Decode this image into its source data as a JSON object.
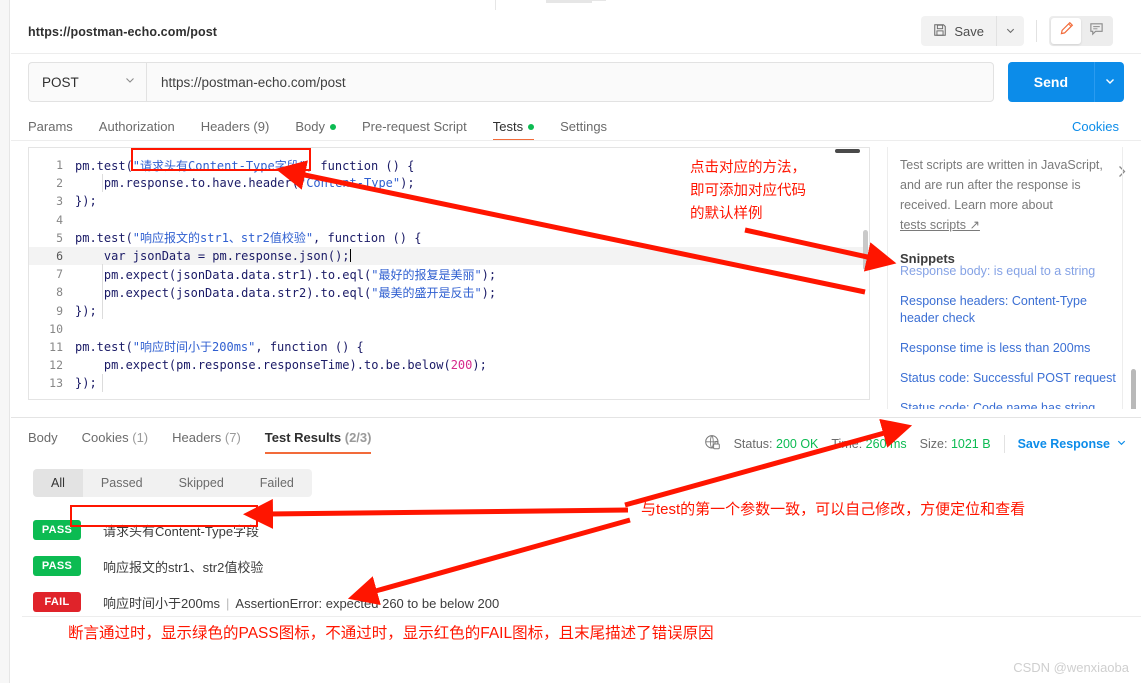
{
  "window": {
    "request_title": "https://postman-echo.com/post"
  },
  "header": {
    "save_label": "Save",
    "save_icon": "floppy-disk-icon",
    "caret_icon": "chevron-down-icon",
    "edit_icon": "pencil-icon",
    "comment_icon": "comment-icon"
  },
  "url_bar": {
    "method": "POST",
    "url": "https://postman-echo.com/post",
    "send_label": "Send"
  },
  "request_tabs": {
    "items": [
      {
        "label": "Params",
        "active": false,
        "dot": false
      },
      {
        "label": "Authorization",
        "active": false,
        "dot": false
      },
      {
        "label": "Headers (9)",
        "active": false,
        "dot": false
      },
      {
        "label": "Body",
        "active": false,
        "dot": true
      },
      {
        "label": "Pre-request Script",
        "active": false,
        "dot": false
      },
      {
        "label": "Tests",
        "active": true,
        "dot": true
      },
      {
        "label": "Settings",
        "active": false,
        "dot": false
      }
    ],
    "cookies_link": "Cookies"
  },
  "editor": {
    "lines": [
      {
        "n": "1",
        "seg": [
          {
            "t": "pm.test(",
            "c": "plain"
          },
          {
            "t": "\"请求头有Content-Type字段\"",
            "c": "str"
          },
          {
            "t": ", function () {",
            "c": "plain"
          }
        ]
      },
      {
        "n": "2",
        "seg": [
          {
            "t": "    pm.response.to.have.header(",
            "c": "plain"
          },
          {
            "t": "\"Content-Type\"",
            "c": "str"
          },
          {
            "t": ");",
            "c": "plain"
          }
        ]
      },
      {
        "n": "3",
        "seg": [
          {
            "t": "});",
            "c": "plain"
          }
        ]
      },
      {
        "n": "4",
        "seg": []
      },
      {
        "n": "5",
        "seg": [
          {
            "t": "pm.test(",
            "c": "plain"
          },
          {
            "t": "\"响应报文的str1、str2值校验\"",
            "c": "str"
          },
          {
            "t": ", function () {",
            "c": "plain"
          }
        ]
      },
      {
        "n": "6",
        "seg": [
          {
            "t": "    var jsonData = pm.response.json();",
            "c": "plain"
          }
        ],
        "highlight": true,
        "caret": true
      },
      {
        "n": "7",
        "seg": [
          {
            "t": "    pm.expect(jsonData.data.str1).to.eql(",
            "c": "plain"
          },
          {
            "t": "\"最好的报复是美丽\"",
            "c": "str"
          },
          {
            "t": ");",
            "c": "plain"
          }
        ]
      },
      {
        "n": "8",
        "seg": [
          {
            "t": "    pm.expect(jsonData.data.str2).to.eql(",
            "c": "plain"
          },
          {
            "t": "\"最美的盛开是反击\"",
            "c": "str"
          },
          {
            "t": ");",
            "c": "plain"
          }
        ]
      },
      {
        "n": "9",
        "seg": [
          {
            "t": "});",
            "c": "plain"
          }
        ]
      },
      {
        "n": "10",
        "seg": []
      },
      {
        "n": "11",
        "seg": [
          {
            "t": "pm.test(",
            "c": "plain"
          },
          {
            "t": "\"响应时间小于200ms\"",
            "c": "str"
          },
          {
            "t": ", function () {",
            "c": "plain"
          }
        ]
      },
      {
        "n": "12",
        "seg": [
          {
            "t": "    pm.expect(pm.response.responseTime).to.be.below(",
            "c": "plain"
          },
          {
            "t": "200",
            "c": "num"
          },
          {
            "t": ");",
            "c": "plain"
          }
        ]
      },
      {
        "n": "13",
        "seg": [
          {
            "t": "});",
            "c": "plain"
          }
        ]
      }
    ]
  },
  "snippets": {
    "description_line1": "Test scripts are written in JavaScript,",
    "description_line2": "and are run after the response is",
    "description_line3": "received. Learn more about",
    "link_label": "tests scripts ↗",
    "title": "Snippets",
    "items": [
      "Response body: is equal to a string",
      "Response headers: Content-Type header check",
      "Response time is less than 200ms",
      "Status code: Successful POST request",
      "Status code: Code name has string"
    ],
    "chevron_icon": "chevron-right-icon"
  },
  "response": {
    "tabs": [
      {
        "label": "Body",
        "count": "",
        "active": false
      },
      {
        "label": "Cookies",
        "count": "(1)",
        "active": false
      },
      {
        "label": "Headers",
        "count": "(7)",
        "active": false
      },
      {
        "label": "Test Results",
        "count": "(2/3)",
        "active": true
      }
    ],
    "status_icon": "globe-lock-icon",
    "status_label": "Status:",
    "status_value": "200 OK",
    "time_label": "Time:",
    "time_value": "260 ms",
    "size_label": "Size:",
    "size_value": "1021 B",
    "save_response_label": "Save Response",
    "save_response_caret": "chevron-down-icon",
    "filters": [
      {
        "label": "All",
        "active": true
      },
      {
        "label": "Passed",
        "active": false
      },
      {
        "label": "Skipped",
        "active": false
      },
      {
        "label": "Failed",
        "active": false
      }
    ],
    "results": [
      {
        "status": "PASS",
        "name": "请求头有Content-Type字段",
        "error": ""
      },
      {
        "status": "PASS",
        "name": "响应报文的str1、str2值校验",
        "error": ""
      },
      {
        "status": "FAIL",
        "name": "响应时间小于200ms",
        "error": "AssertionError: expected 260 to be below 200"
      }
    ]
  },
  "annotations": {
    "snippet_note_line1": "点击对应的方法，",
    "snippet_note_line2": "即可添加对应代码",
    "snippet_note_line3": "的默认样例",
    "result_name_note": "与test的第一个参数一致，可以自己修改，方便定位和查看",
    "bottom_note": "断言通过时，显示绿色的PASS图标，不通过时，显示红色的FAIL图标，且末尾描述了错误原因",
    "color": "#ff1500"
  },
  "watermark": "CSDN @wenxiaoba"
}
